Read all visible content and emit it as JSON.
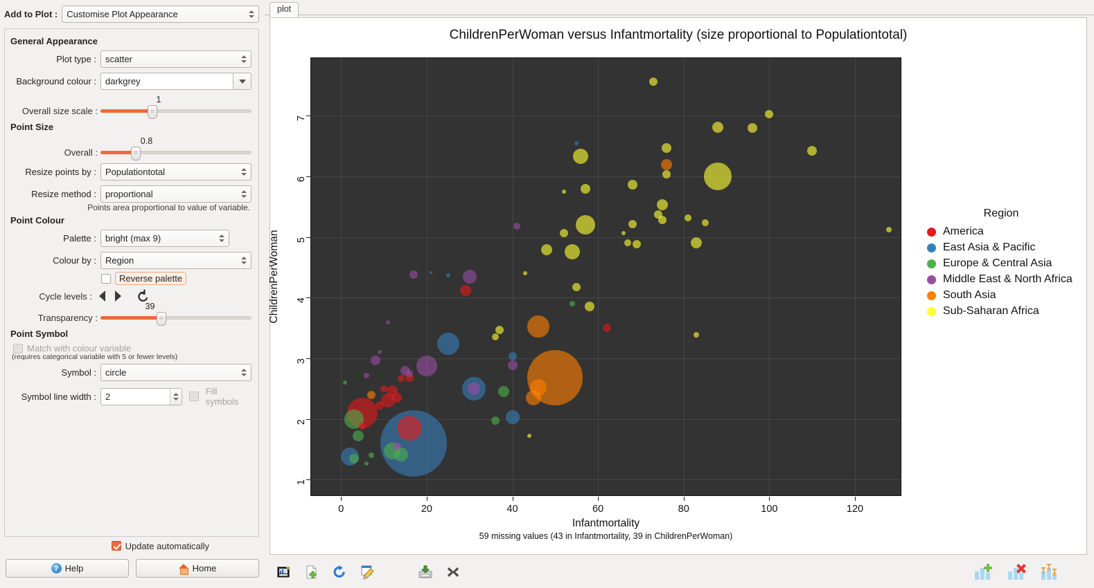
{
  "left_panel": {
    "add_to_plot_label": "Add to Plot :",
    "add_to_plot_value": "Customise Plot Appearance",
    "sections": {
      "general": {
        "title": "General Appearance",
        "plot_type_label": "Plot type :",
        "plot_type_value": "scatter",
        "background_colour_label": "Background colour :",
        "background_colour_value": "darkgrey",
        "overall_size_scale_label": "Overall size scale :",
        "overall_size_scale_value": "1"
      },
      "point_size": {
        "title": "Point Size",
        "overall_label": "Overall :",
        "overall_value": "0.8",
        "resize_points_by_label": "Resize points by :",
        "resize_points_by_value": "Populationtotal",
        "resize_method_label": "Resize method :",
        "resize_method_value": "proportional",
        "note": "Points area proportional to value of variable."
      },
      "point_colour": {
        "title": "Point Colour",
        "palette_label": "Palette :",
        "palette_value": "bright (max 9)",
        "colour_by_label": "Colour by :",
        "colour_by_value": "Region",
        "reverse_palette_label": "Reverse palette",
        "reverse_palette_checked": false,
        "cycle_levels_label": "Cycle levels :",
        "transparency_label": "Transparency :",
        "transparency_value": "39"
      },
      "point_symbol": {
        "title": "Point Symbol",
        "match_colour_label": "Match with colour variable",
        "match_colour_checked": false,
        "match_colour_note": "(requires categorical variable with 5 or fewer levels)",
        "symbol_label": "Symbol :",
        "symbol_value": "circle",
        "symbol_line_width_label": "Symbol line width :",
        "symbol_line_width_value": "2",
        "fill_symbols_label": "Fill symbols",
        "fill_symbols_checked": false
      }
    },
    "update_automatically_label": "Update automatically",
    "update_automatically_checked": true,
    "help_button": "Help",
    "home_button": "Home"
  },
  "plot_panel": {
    "tab_label": "plot",
    "toolbar_icons": [
      "plot-image-icon",
      "new-document-icon",
      "refresh-icon",
      "edit-icon",
      "save-disk-icon",
      "close-x-icon"
    ],
    "toolbar_right_icons": [
      "add-chart-icon",
      "remove-chart-icon",
      "errorbar-chart-icon"
    ]
  },
  "chart_data": {
    "type": "scatter",
    "title": "ChildrenPerWoman versus Infantmortality (size proportional to Populationtotal)",
    "xlabel": "Infantmortality",
    "ylabel": "ChildrenPerWoman",
    "subtitle": "59 missing values (43 in Infantmortality, 39 in ChildrenPerWoman)",
    "background": "#333333",
    "grid": true,
    "legend_position": "right",
    "legend_title": "Region",
    "xlim": [
      -7,
      131
    ],
    "ylim": [
      0.72,
      7.95
    ],
    "xticks": [
      0,
      20,
      40,
      60,
      80,
      100,
      120
    ],
    "yticks": [
      1,
      2,
      3,
      4,
      5,
      6,
      7
    ],
    "size_variable": "Populationtotal",
    "point_opacity": 0.61,
    "series": [
      {
        "name": "America",
        "color": "#e41a1c"
      },
      {
        "name": "East Asia & Pacific",
        "color": "#377eb8"
      },
      {
        "name": "Europe & Central Asia",
        "color": "#4daf4a"
      },
      {
        "name": "Middle East & North Africa",
        "color": "#984ea3"
      },
      {
        "name": "South Asia",
        "color": "#ff7f00"
      },
      {
        "name": "Sub-Saharan Africa",
        "color": "#ffff33"
      }
    ],
    "points": [
      {
        "x": 73,
        "y": 7.56,
        "r": 6,
        "g": 5
      },
      {
        "x": 100,
        "y": 7.03,
        "r": 6,
        "g": 5
      },
      {
        "x": 88,
        "y": 6.81,
        "r": 8,
        "g": 5
      },
      {
        "x": 96,
        "y": 6.8,
        "r": 7,
        "g": 5
      },
      {
        "x": 110,
        "y": 6.42,
        "r": 7,
        "g": 5
      },
      {
        "x": 76,
        "y": 6.47,
        "r": 7,
        "g": 5
      },
      {
        "x": 56,
        "y": 6.33,
        "r": 11,
        "g": 5
      },
      {
        "x": 55,
        "y": 6.55,
        "r": 3,
        "g": 1
      },
      {
        "x": 76,
        "y": 6.19,
        "r": 8,
        "g": 4
      },
      {
        "x": 76,
        "y": 6.03,
        "r": 6,
        "g": 5
      },
      {
        "x": 88,
        "y": 6.0,
        "r": 20,
        "g": 5
      },
      {
        "x": 68,
        "y": 5.86,
        "r": 7,
        "g": 5
      },
      {
        "x": 57,
        "y": 5.79,
        "r": 7,
        "g": 5
      },
      {
        "x": 52,
        "y": 5.75,
        "r": 3,
        "g": 5
      },
      {
        "x": 75,
        "y": 5.53,
        "r": 8,
        "g": 5
      },
      {
        "x": 74,
        "y": 5.37,
        "r": 6,
        "g": 5
      },
      {
        "x": 75,
        "y": 5.28,
        "r": 6,
        "g": 5
      },
      {
        "x": 81,
        "y": 5.32,
        "r": 5,
        "g": 5
      },
      {
        "x": 68,
        "y": 5.21,
        "r": 6,
        "g": 5
      },
      {
        "x": 57,
        "y": 5.2,
        "r": 14,
        "g": 5
      },
      {
        "x": 66,
        "y": 5.07,
        "r": 3,
        "g": 5
      },
      {
        "x": 85,
        "y": 5.24,
        "r": 5,
        "g": 5
      },
      {
        "x": 128,
        "y": 5.12,
        "r": 4,
        "g": 5
      },
      {
        "x": 41,
        "y": 5.18,
        "r": 5,
        "g": 3
      },
      {
        "x": 52,
        "y": 5.07,
        "r": 6,
        "g": 5
      },
      {
        "x": 69,
        "y": 4.88,
        "r": 6,
        "g": 5
      },
      {
        "x": 67,
        "y": 4.9,
        "r": 5,
        "g": 5
      },
      {
        "x": 83,
        "y": 4.91,
        "r": 8,
        "g": 5
      },
      {
        "x": 48,
        "y": 4.79,
        "r": 8,
        "g": 5
      },
      {
        "x": 54,
        "y": 4.76,
        "r": 11,
        "g": 5
      },
      {
        "x": 43,
        "y": 4.4,
        "r": 3,
        "g": 5
      },
      {
        "x": 55,
        "y": 4.17,
        "r": 6,
        "g": 5
      },
      {
        "x": 17,
        "y": 4.38,
        "r": 6,
        "g": 3
      },
      {
        "x": 30,
        "y": 4.35,
        "r": 10,
        "g": 3
      },
      {
        "x": 25,
        "y": 4.37,
        "r": 3,
        "g": 1
      },
      {
        "x": 21,
        "y": 4.42,
        "r": 2,
        "g": 1
      },
      {
        "x": 29,
        "y": 4.12,
        "r": 8,
        "g": 0
      },
      {
        "x": 58,
        "y": 3.86,
        "r": 7,
        "g": 5
      },
      {
        "x": 54,
        "y": 3.9,
        "r": 4,
        "g": 2
      },
      {
        "x": 46,
        "y": 3.52,
        "r": 16,
        "g": 4
      },
      {
        "x": 62,
        "y": 3.5,
        "r": 6,
        "g": 0
      },
      {
        "x": 37,
        "y": 3.47,
        "r": 6,
        "g": 5
      },
      {
        "x": 83,
        "y": 3.39,
        "r": 4,
        "g": 5
      },
      {
        "x": 11,
        "y": 3.59,
        "r": 3,
        "g": 3
      },
      {
        "x": 36,
        "y": 3.35,
        "r": 5,
        "g": 5
      },
      {
        "x": 25,
        "y": 3.24,
        "r": 16,
        "g": 1
      },
      {
        "x": 9,
        "y": 3.1,
        "r": 3,
        "g": 3
      },
      {
        "x": 40,
        "y": 3.04,
        "r": 6,
        "g": 1
      },
      {
        "x": 8,
        "y": 2.97,
        "r": 7,
        "g": 3
      },
      {
        "x": 20,
        "y": 2.88,
        "r": 15,
        "g": 3
      },
      {
        "x": 40,
        "y": 2.89,
        "r": 7,
        "g": 3
      },
      {
        "x": 50,
        "y": 2.68,
        "r": 40,
        "g": 4
      },
      {
        "x": 16,
        "y": 2.75,
        "r": 5,
        "g": 3
      },
      {
        "x": 15,
        "y": 2.8,
        "r": 7,
        "g": 3
      },
      {
        "x": 6,
        "y": 2.72,
        "r": 4,
        "g": 3
      },
      {
        "x": 14,
        "y": 2.67,
        "r": 5,
        "g": 0
      },
      {
        "x": 16,
        "y": 2.68,
        "r": 6,
        "g": 0
      },
      {
        "x": 31,
        "y": 2.5,
        "r": 17,
        "g": 1
      },
      {
        "x": 31,
        "y": 2.5,
        "r": 9,
        "g": 3
      },
      {
        "x": 46,
        "y": 2.52,
        "r": 12,
        "g": 4
      },
      {
        "x": 45,
        "y": 2.35,
        "r": 11,
        "g": 4
      },
      {
        "x": 38,
        "y": 2.45,
        "r": 8,
        "g": 2
      },
      {
        "x": 10,
        "y": 2.5,
        "r": 5,
        "g": 0
      },
      {
        "x": 12,
        "y": 2.46,
        "r": 8,
        "g": 0
      },
      {
        "x": 13,
        "y": 2.35,
        "r": 7,
        "g": 0
      },
      {
        "x": 11,
        "y": 2.3,
        "r": 10,
        "g": 0
      },
      {
        "x": 9,
        "y": 2.23,
        "r": 6,
        "g": 0
      },
      {
        "x": 5,
        "y": 2.1,
        "r": 22,
        "g": 0
      },
      {
        "x": 3,
        "y": 2.0,
        "r": 14,
        "g": 2
      },
      {
        "x": 40,
        "y": 2.03,
        "r": 10,
        "g": 1
      },
      {
        "x": 7,
        "y": 2.4,
        "r": 6,
        "g": 4
      },
      {
        "x": 36,
        "y": 1.97,
        "r": 6,
        "g": 2
      },
      {
        "x": 16,
        "y": 1.85,
        "r": 18,
        "g": 0
      },
      {
        "x": 17,
        "y": 1.6,
        "r": 48,
        "g": 1
      },
      {
        "x": 4,
        "y": 1.72,
        "r": 8,
        "g": 2
      },
      {
        "x": 5,
        "y": 1.88,
        "r": 5,
        "g": 0
      },
      {
        "x": 2,
        "y": 1.38,
        "r": 13,
        "g": 1
      },
      {
        "x": 12,
        "y": 1.47,
        "r": 12,
        "g": 2
      },
      {
        "x": 14,
        "y": 1.42,
        "r": 10,
        "g": 2
      },
      {
        "x": 3,
        "y": 1.35,
        "r": 7,
        "g": 2
      },
      {
        "x": 13,
        "y": 1.55,
        "r": 6,
        "g": 3
      },
      {
        "x": 7,
        "y": 1.4,
        "r": 4,
        "g": 2
      },
      {
        "x": 1,
        "y": 2.6,
        "r": 3,
        "g": 2
      },
      {
        "x": 44,
        "y": 1.72,
        "r": 3,
        "g": 5
      },
      {
        "x": 6,
        "y": 1.27,
        "r": 3,
        "g": 2
      }
    ]
  }
}
